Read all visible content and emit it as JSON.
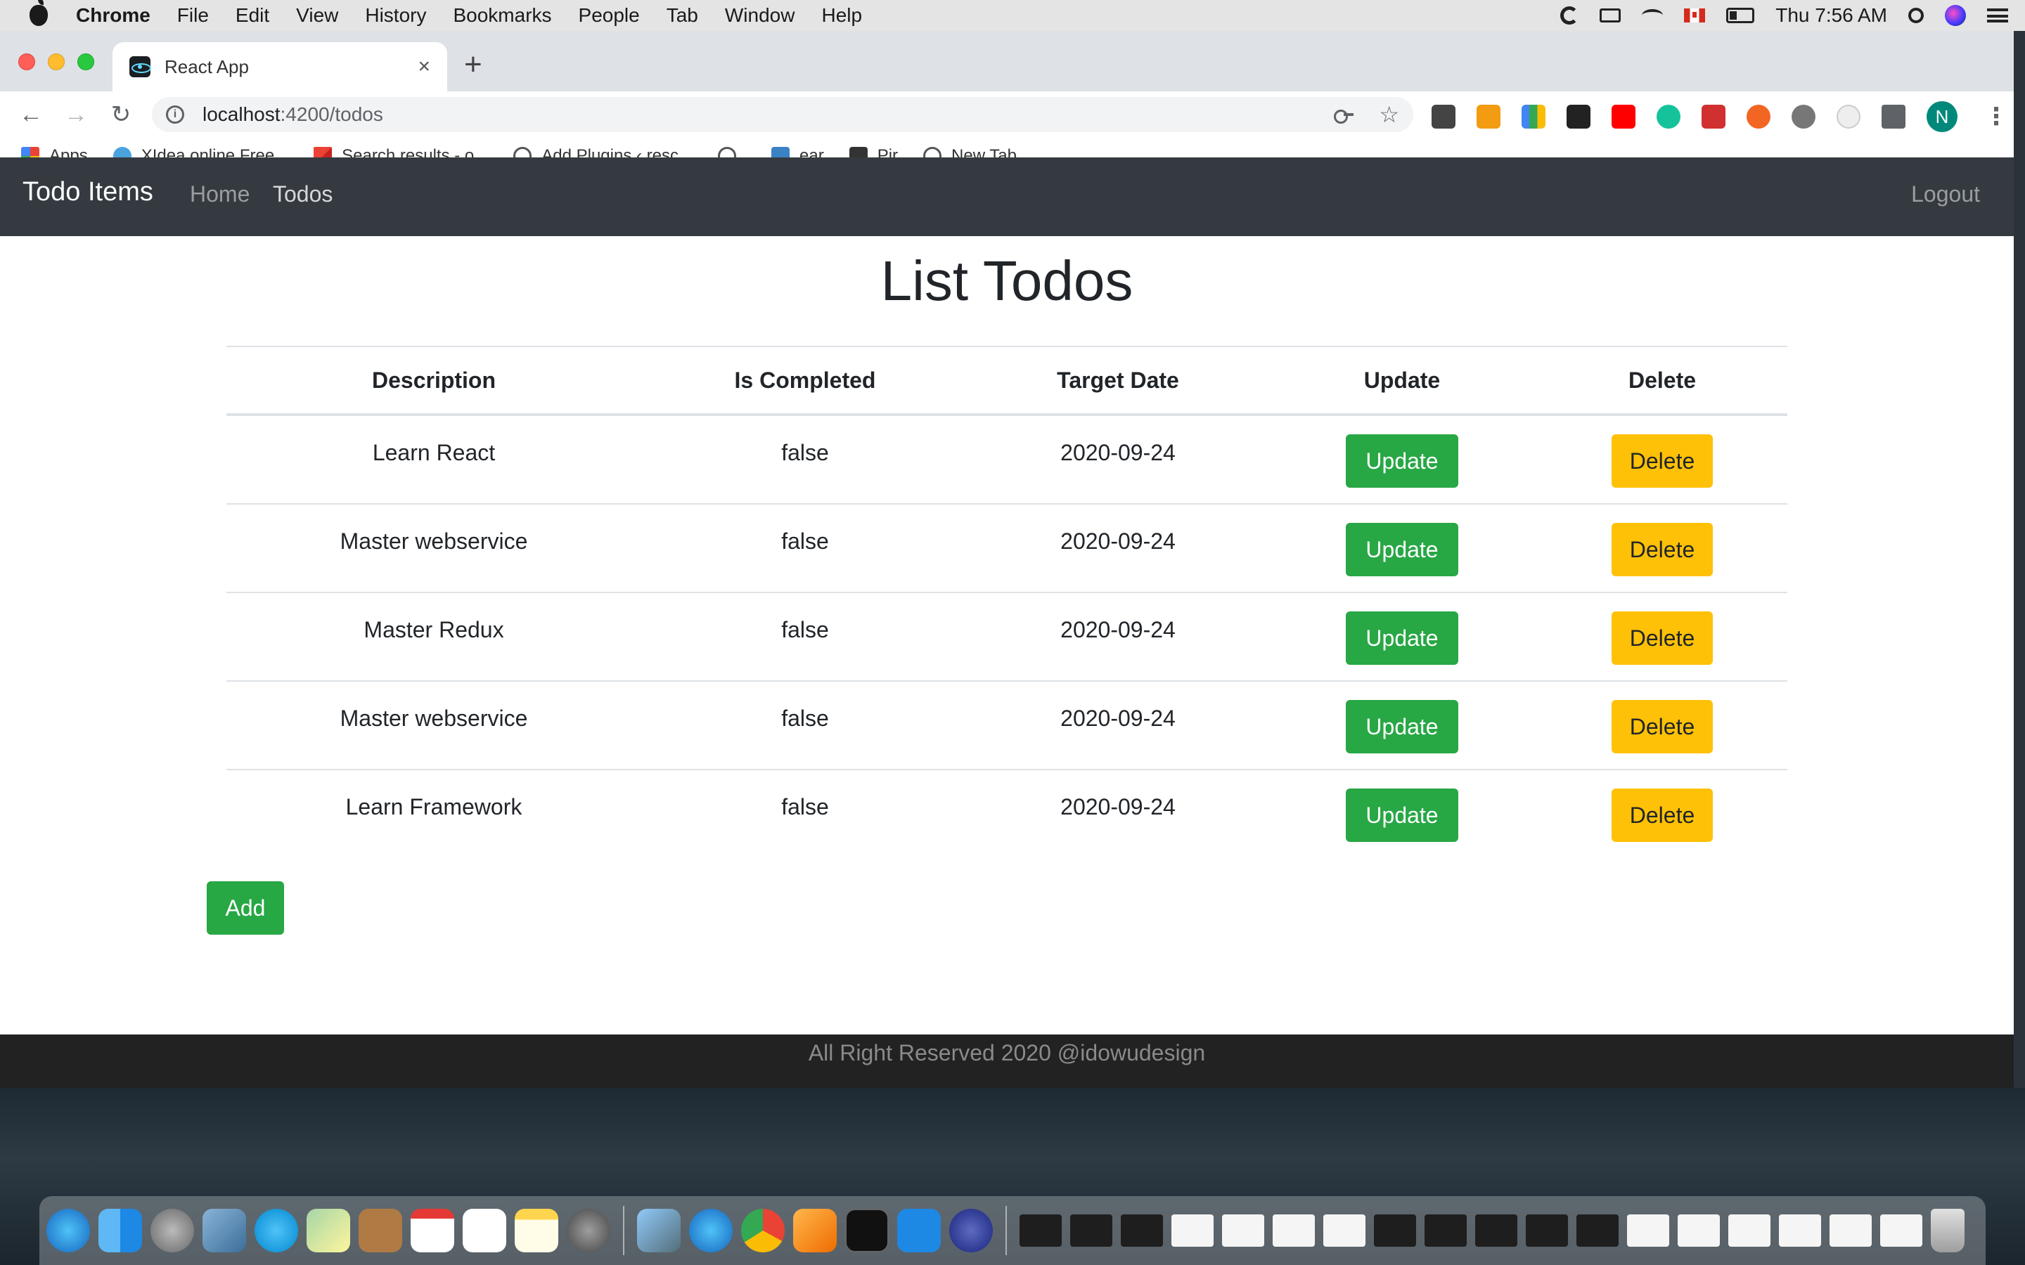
{
  "menubar": {
    "app_name": "Chrome",
    "items": [
      "File",
      "Edit",
      "View",
      "History",
      "Bookmarks",
      "People",
      "Tab",
      "Window",
      "Help"
    ],
    "clock": "Thu 7:56 AM"
  },
  "browser": {
    "tab_title": "React App",
    "tab_close": "×",
    "new_tab": "+",
    "url_host": "localhost",
    "url_path": ":4200/todos",
    "bookmarks": [
      "Apps",
      "XIdea.online Free...",
      "Search results - o...",
      "Add Plugins ‹ resc...",
      "ear",
      "Pir",
      "New Tab"
    ],
    "profile_initial": "N"
  },
  "navbar": {
    "brand": "Todo Items",
    "home": "Home",
    "todos": "Todos",
    "logout": "Logout"
  },
  "page": {
    "title": "List Todos",
    "add_label": "Add"
  },
  "table": {
    "headers": [
      "Description",
      "Is Completed",
      "Target Date",
      "Update",
      "Delete"
    ],
    "rows": [
      {
        "description": "Learn React",
        "completed": "false",
        "date": "2020-09-24",
        "update": "Update",
        "delete": "Delete"
      },
      {
        "description": "Master webservice",
        "completed": "false",
        "date": "2020-09-24",
        "update": "Update",
        "delete": "Delete"
      },
      {
        "description": "Master Redux",
        "completed": "false",
        "date": "2020-09-24",
        "update": "Update",
        "delete": "Delete"
      },
      {
        "description": "Master webservice",
        "completed": "false",
        "date": "2020-09-24",
        "update": "Update",
        "delete": "Delete"
      },
      {
        "description": "Learn Framework",
        "completed": "false",
        "date": "2020-09-24",
        "update": "Update",
        "delete": "Delete"
      }
    ]
  },
  "footer": {
    "text": "All Right Reserved 2020 @idowudesign"
  },
  "colors": {
    "navbar": "#343a40",
    "success": "#28a745",
    "warning": "#ffc107",
    "footer": "#222222"
  }
}
